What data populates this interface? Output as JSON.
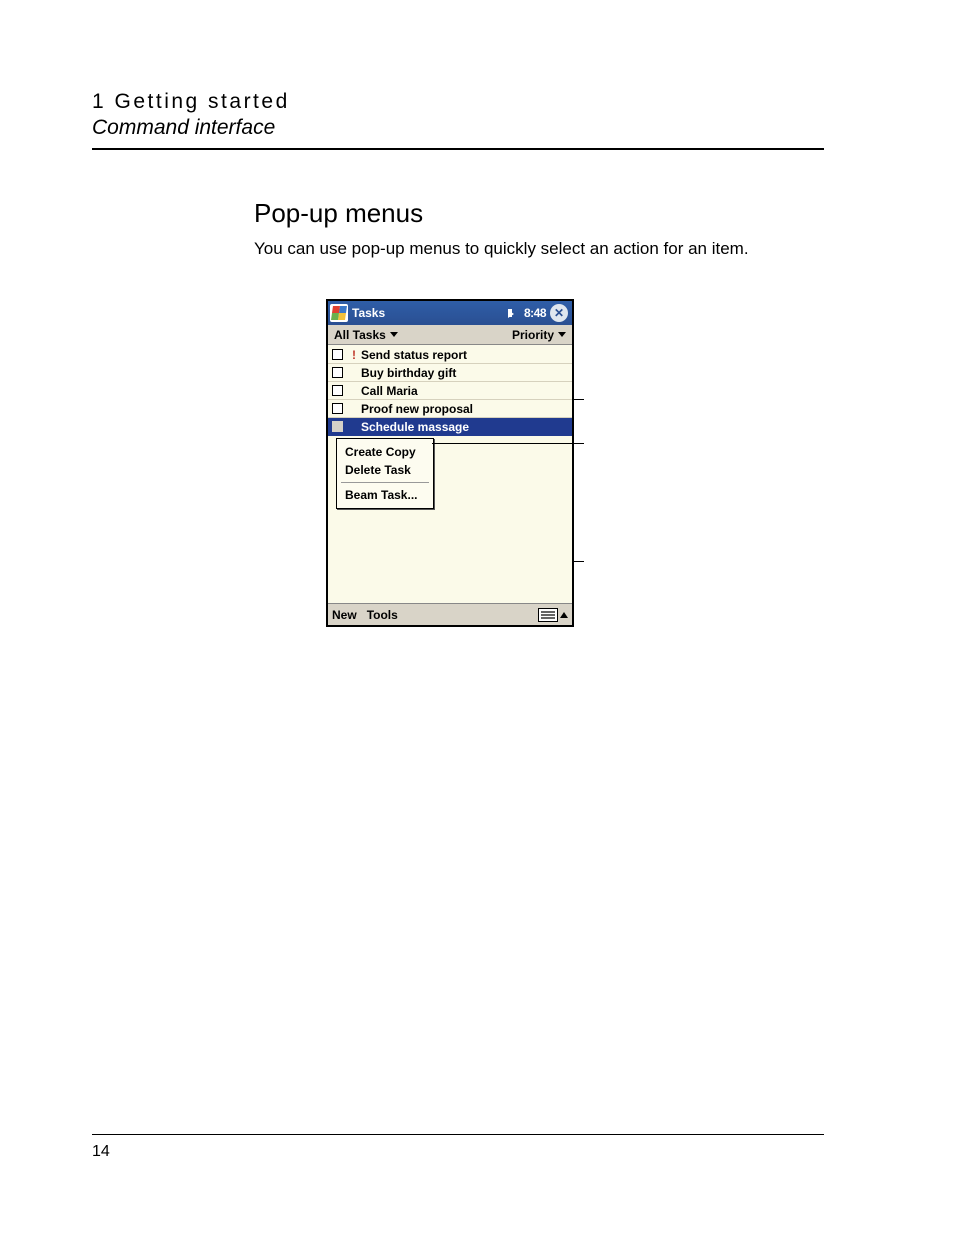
{
  "header": {
    "chapter": "1 Getting started",
    "section": "Command interface"
  },
  "heading": "Pop-up menus",
  "body_text": "You can use pop-up menus to quickly select an action for an item.",
  "device": {
    "titlebar": {
      "title": "Tasks",
      "time": "8:48"
    },
    "filter": {
      "left": "All Tasks",
      "right": "Priority"
    },
    "tasks": [
      {
        "label": "Send status report",
        "priority": "!",
        "selected": false
      },
      {
        "label": "Buy birthday gift",
        "priority": "",
        "selected": false
      },
      {
        "label": "Call Maria",
        "priority": "",
        "selected": false
      },
      {
        "label": "Proof new proposal",
        "priority": "",
        "selected": false
      },
      {
        "label": "Schedule massage",
        "priority": "",
        "selected": true
      }
    ],
    "popup": {
      "items": [
        "Create Copy",
        "Delete Task"
      ],
      "footer_item": "Beam Task..."
    },
    "bottombar": {
      "new": "New",
      "tools": "Tools"
    }
  },
  "page_number": "14"
}
